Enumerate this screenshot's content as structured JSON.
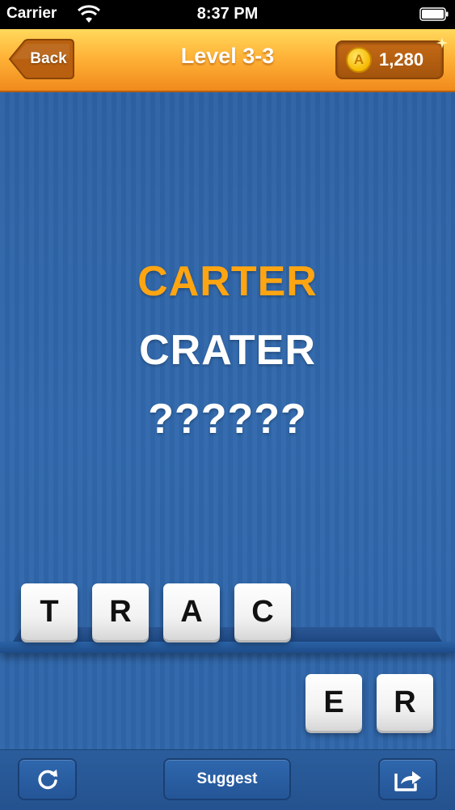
{
  "status_bar": {
    "carrier": "Carrier",
    "time": "8:37 PM"
  },
  "header": {
    "back_label": "Back",
    "level_title": "Level 3-3",
    "coin_symbol": "A",
    "coins": "1,280"
  },
  "board": {
    "words": [
      "CARTER",
      "CRATER",
      "??????"
    ],
    "word_colors": [
      "#ffa512",
      "#ffffff",
      "#ffffff"
    ],
    "shelf_tiles": [
      "T",
      "R",
      "A",
      "C"
    ],
    "tray_tiles": [
      "E",
      "R"
    ]
  },
  "bottom_bar": {
    "restart_icon": "restart-icon",
    "suggest_label": "Suggest",
    "share_icon": "share-icon"
  },
  "colors": {
    "background": "#2f65a8",
    "header_accent": "#ffb338",
    "highlight_word": "#ffa512"
  }
}
